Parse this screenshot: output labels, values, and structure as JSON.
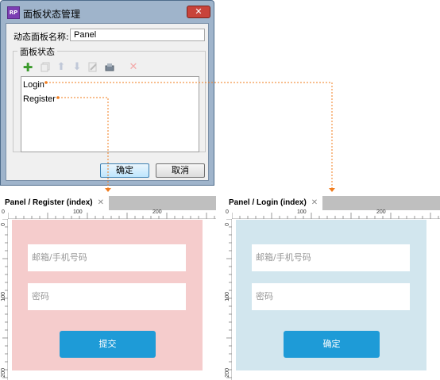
{
  "dialog": {
    "title": "面板状态管理",
    "app_icon_text": "RP",
    "close_glyph": "✕",
    "name_label": "动态面板名称:",
    "name_value": "Panel",
    "group_title": "面板状态",
    "states": [
      "Login",
      "Register"
    ],
    "ok_label": "确定",
    "cancel_label": "取消",
    "toolbar_icons": [
      "add-icon",
      "duplicate-icon",
      "move-up-icon",
      "move-down-icon",
      "edit-icon",
      "edit-all-icon",
      "delete-icon"
    ]
  },
  "panels": [
    {
      "tab_label": "Panel / Register (index)",
      "tab_close": "✕",
      "bg_color": "#f5cccc",
      "email_placeholder": "邮箱/手机号码",
      "password_placeholder": "密码",
      "button_label": "提交"
    },
    {
      "tab_label": "Panel / Login (index)",
      "tab_close": "✕",
      "bg_color": "#d2e6ee",
      "email_placeholder": "邮箱/手机号码",
      "password_placeholder": "密码",
      "button_label": "确定"
    }
  ],
  "ruler": {
    "h_labels": [
      "0",
      "100",
      "200"
    ],
    "v_labels": [
      "0",
      "100",
      "200"
    ]
  },
  "colors": {
    "connector": "#f07c1e",
    "accent_button": "#1e9bd7"
  }
}
